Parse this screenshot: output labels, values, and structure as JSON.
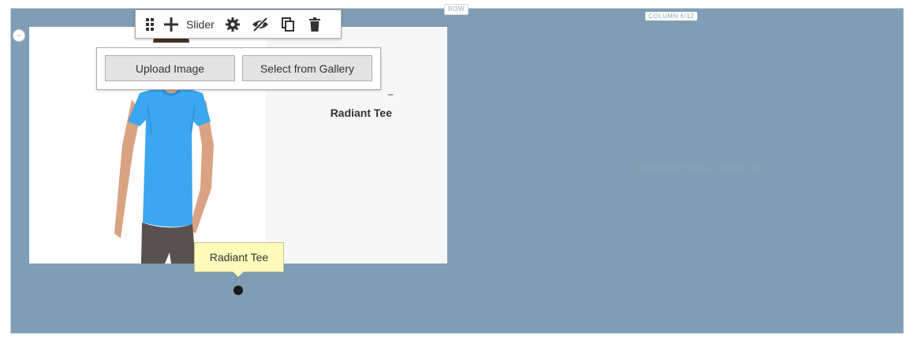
{
  "row": {
    "label": "ROW",
    "background": "#7f9db5"
  },
  "column": {
    "label": "COLUMN 6/12",
    "placeholder": "Drag content types or columns here"
  },
  "toolbar": {
    "title": "Slider",
    "icons": [
      "move-handle-icon",
      "plus-icon",
      "gear-icon",
      "eye-slash-icon",
      "duplicate-icon",
      "trash-icon"
    ]
  },
  "upload": {
    "upload_label": "Upload Image",
    "gallery_label": "Select from Gallery"
  },
  "slide": {
    "title": "Radiant Tee",
    "dash": "–"
  },
  "tooltip": {
    "text": "Radiant Tee",
    "background": "#fffbbb"
  },
  "navigation": {
    "active_dot_color": "#1a1a1a"
  }
}
